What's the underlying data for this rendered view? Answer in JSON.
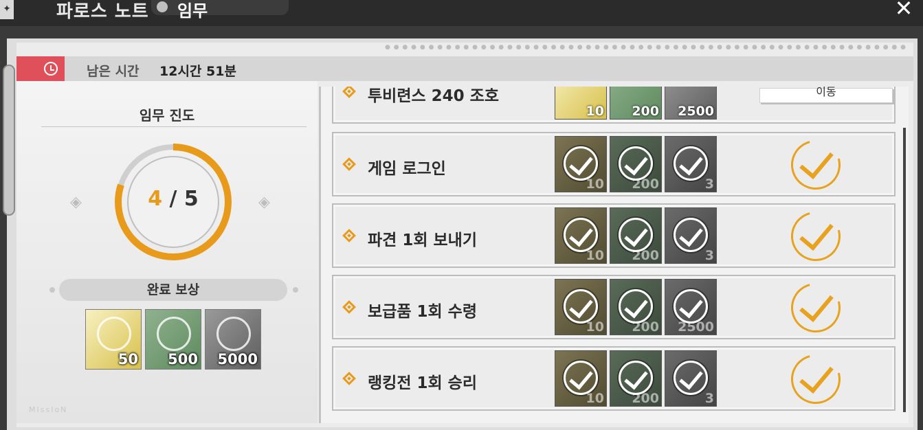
{
  "header": {
    "parent_title": "파로스 노트",
    "current_title": "임무"
  },
  "timer": {
    "label": "남은 시간",
    "value": "12시간 51분"
  },
  "progress": {
    "title": "임무 진도",
    "completed": "4",
    "separator": " / ",
    "total": "5",
    "fraction": 0.8
  },
  "completion_reward": {
    "label": "완료 보상",
    "items": [
      {
        "qty": "50"
      },
      {
        "qty": "500"
      },
      {
        "qty": "5000"
      }
    ]
  },
  "watermark": "MIssIoN",
  "missions": [
    {
      "title": "투비련스 240 조호",
      "rewards": [
        "10",
        "200",
        "2500"
      ],
      "status": "in-progress",
      "action": "이동"
    },
    {
      "title": "게임 로그인",
      "rewards": [
        "10",
        "200",
        "3"
      ],
      "status": "claimed"
    },
    {
      "title": "파견 1회 보내기",
      "rewards": [
        "10",
        "200",
        "3"
      ],
      "status": "claimed"
    },
    {
      "title": "보급품 1회 수령",
      "rewards": [
        "10",
        "200",
        "2500"
      ],
      "status": "claimed"
    },
    {
      "title": "랭킹전 1회 승리",
      "rewards": [
        "10",
        "200",
        "3"
      ],
      "status": "claimed"
    }
  ],
  "colors": {
    "accent": "#e89a1a",
    "timer_badge": "#e0505a"
  }
}
